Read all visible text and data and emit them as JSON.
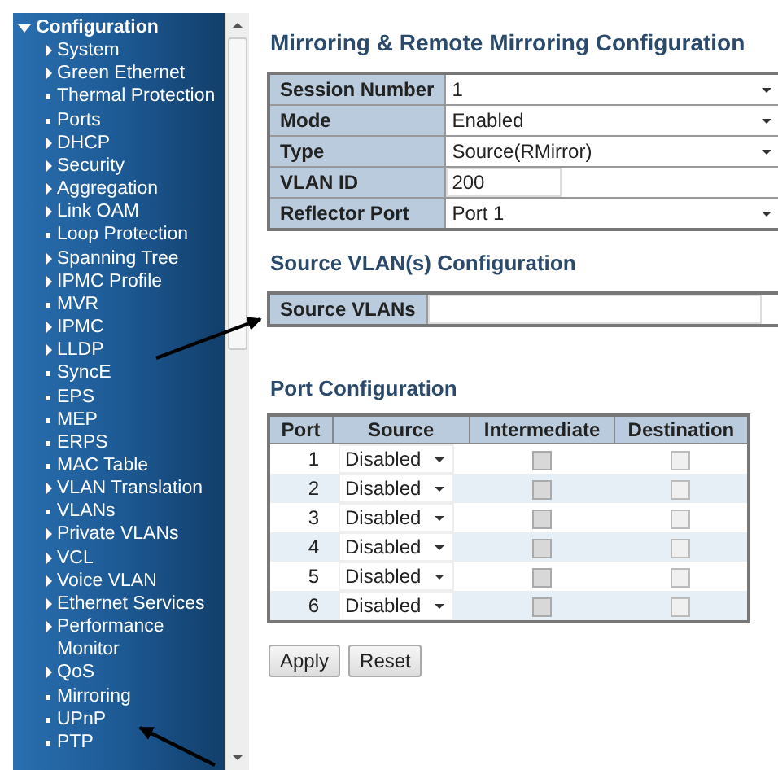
{
  "sidebar": {
    "header": {
      "label": "Configuration",
      "expanded": true
    },
    "items": [
      {
        "label": "System",
        "kind": "folder"
      },
      {
        "label": "Green Ethernet",
        "kind": "folder"
      },
      {
        "label": "Thermal Protection",
        "kind": "page"
      },
      {
        "label": "Ports",
        "kind": "page"
      },
      {
        "label": "DHCP",
        "kind": "folder"
      },
      {
        "label": "Security",
        "kind": "folder"
      },
      {
        "label": "Aggregation",
        "kind": "folder"
      },
      {
        "label": "Link OAM",
        "kind": "folder"
      },
      {
        "label": "Loop Protection",
        "kind": "page"
      },
      {
        "label": "Spanning Tree",
        "kind": "folder"
      },
      {
        "label": "IPMC Profile",
        "kind": "folder"
      },
      {
        "label": "MVR",
        "kind": "page"
      },
      {
        "label": "IPMC",
        "kind": "folder"
      },
      {
        "label": "LLDP",
        "kind": "folder"
      },
      {
        "label": "SyncE",
        "kind": "page"
      },
      {
        "label": "EPS",
        "kind": "page"
      },
      {
        "label": "MEP",
        "kind": "page"
      },
      {
        "label": "ERPS",
        "kind": "page"
      },
      {
        "label": "MAC Table",
        "kind": "page"
      },
      {
        "label": "VLAN Translation",
        "kind": "folder"
      },
      {
        "label": "VLANs",
        "kind": "page"
      },
      {
        "label": "Private VLANs",
        "kind": "folder"
      },
      {
        "label": "VCL",
        "kind": "folder"
      },
      {
        "label": "Voice VLAN",
        "kind": "folder"
      },
      {
        "label": "Ethernet Services",
        "kind": "folder"
      },
      {
        "label": "Performance Monitor",
        "kind": "folder"
      },
      {
        "label": "QoS",
        "kind": "folder"
      },
      {
        "label": "Mirroring",
        "kind": "page"
      },
      {
        "label": "UPnP",
        "kind": "page"
      },
      {
        "label": "PTP",
        "kind": "page"
      }
    ]
  },
  "mirroring": {
    "title": "Mirroring & Remote Mirroring Configuration",
    "fields": [
      {
        "label": "Session Number",
        "value": "1",
        "kind": "select"
      },
      {
        "label": "Mode",
        "value": "Enabled",
        "kind": "select"
      },
      {
        "label": "Type",
        "value": "Source(RMirror)",
        "kind": "select"
      },
      {
        "label": "VLAN ID",
        "value": "200",
        "kind": "input"
      },
      {
        "label": "Reflector Port",
        "value": "Port 1",
        "kind": "select"
      }
    ]
  },
  "source_vlans": {
    "title": "Source VLAN(s) Configuration",
    "label": "Source VLANs"
  },
  "port_config": {
    "title": "Port Configuration",
    "columns": [
      "Port",
      "Source",
      "Intermediate",
      "Destination"
    ],
    "rows": [
      {
        "port": "1",
        "source": "Disabled",
        "intermediate": {
          "checked": false,
          "disabled": true
        },
        "destination": {
          "checked": false,
          "disabled": true
        }
      },
      {
        "port": "2",
        "source": "Disabled",
        "intermediate": {
          "checked": false,
          "disabled": true
        },
        "destination": {
          "checked": false,
          "disabled": true
        }
      },
      {
        "port": "3",
        "source": "Disabled",
        "intermediate": {
          "checked": false,
          "disabled": true
        },
        "destination": {
          "checked": false,
          "disabled": true
        }
      },
      {
        "port": "4",
        "source": "Disabled",
        "intermediate": {
          "checked": false,
          "disabled": true
        },
        "destination": {
          "checked": false,
          "disabled": true
        }
      },
      {
        "port": "5",
        "source": "Disabled",
        "intermediate": {
          "checked": false,
          "disabled": true
        },
        "destination": {
          "checked": false,
          "disabled": true
        }
      },
      {
        "port": "6",
        "source": "Disabled",
        "intermediate": {
          "checked": false,
          "disabled": true
        },
        "destination": {
          "checked": false,
          "disabled": true
        }
      }
    ]
  },
  "buttons": [
    "Apply",
    "Reset"
  ]
}
